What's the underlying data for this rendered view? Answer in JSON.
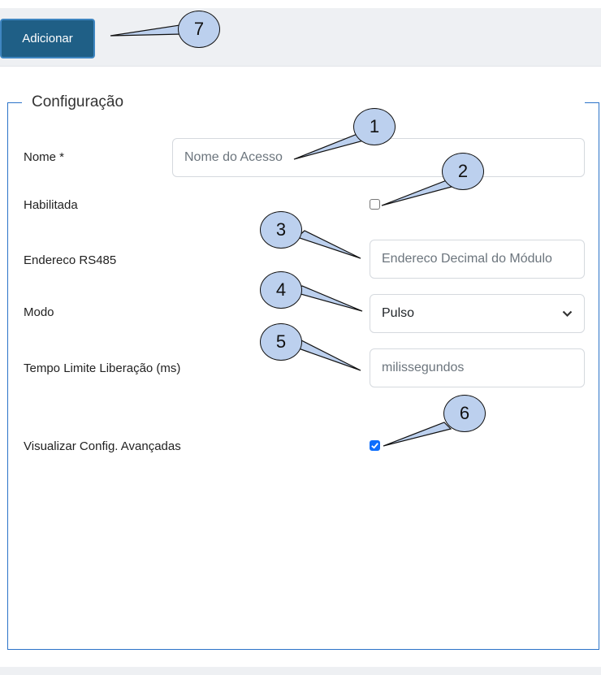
{
  "toolbar": {
    "add_label": "Adicionar"
  },
  "section": {
    "legend": "Configuração"
  },
  "form": {
    "nome": {
      "label": "Nome *",
      "placeholder": "Nome do Acesso"
    },
    "habilitada": {
      "label": "Habilitada",
      "checked": false
    },
    "endereco": {
      "label": "Endereco RS485",
      "placeholder": "Endereco Decimal do Módulo"
    },
    "modo": {
      "label": "Modo",
      "value": "Pulso"
    },
    "tempo": {
      "label": "Tempo Limite Liberação (ms)",
      "placeholder": "milissegundos"
    },
    "avancadas": {
      "label": "Visualizar Config. Avançadas",
      "checked": true
    }
  },
  "callouts": [
    "1",
    "2",
    "3",
    "4",
    "5",
    "6",
    "7"
  ],
  "colors": {
    "primary_button": "#1f5f86",
    "fieldset_border": "#2b73c8",
    "callout_fill": "#bcd0ee",
    "checkbox_checked": "#0d6efd"
  }
}
